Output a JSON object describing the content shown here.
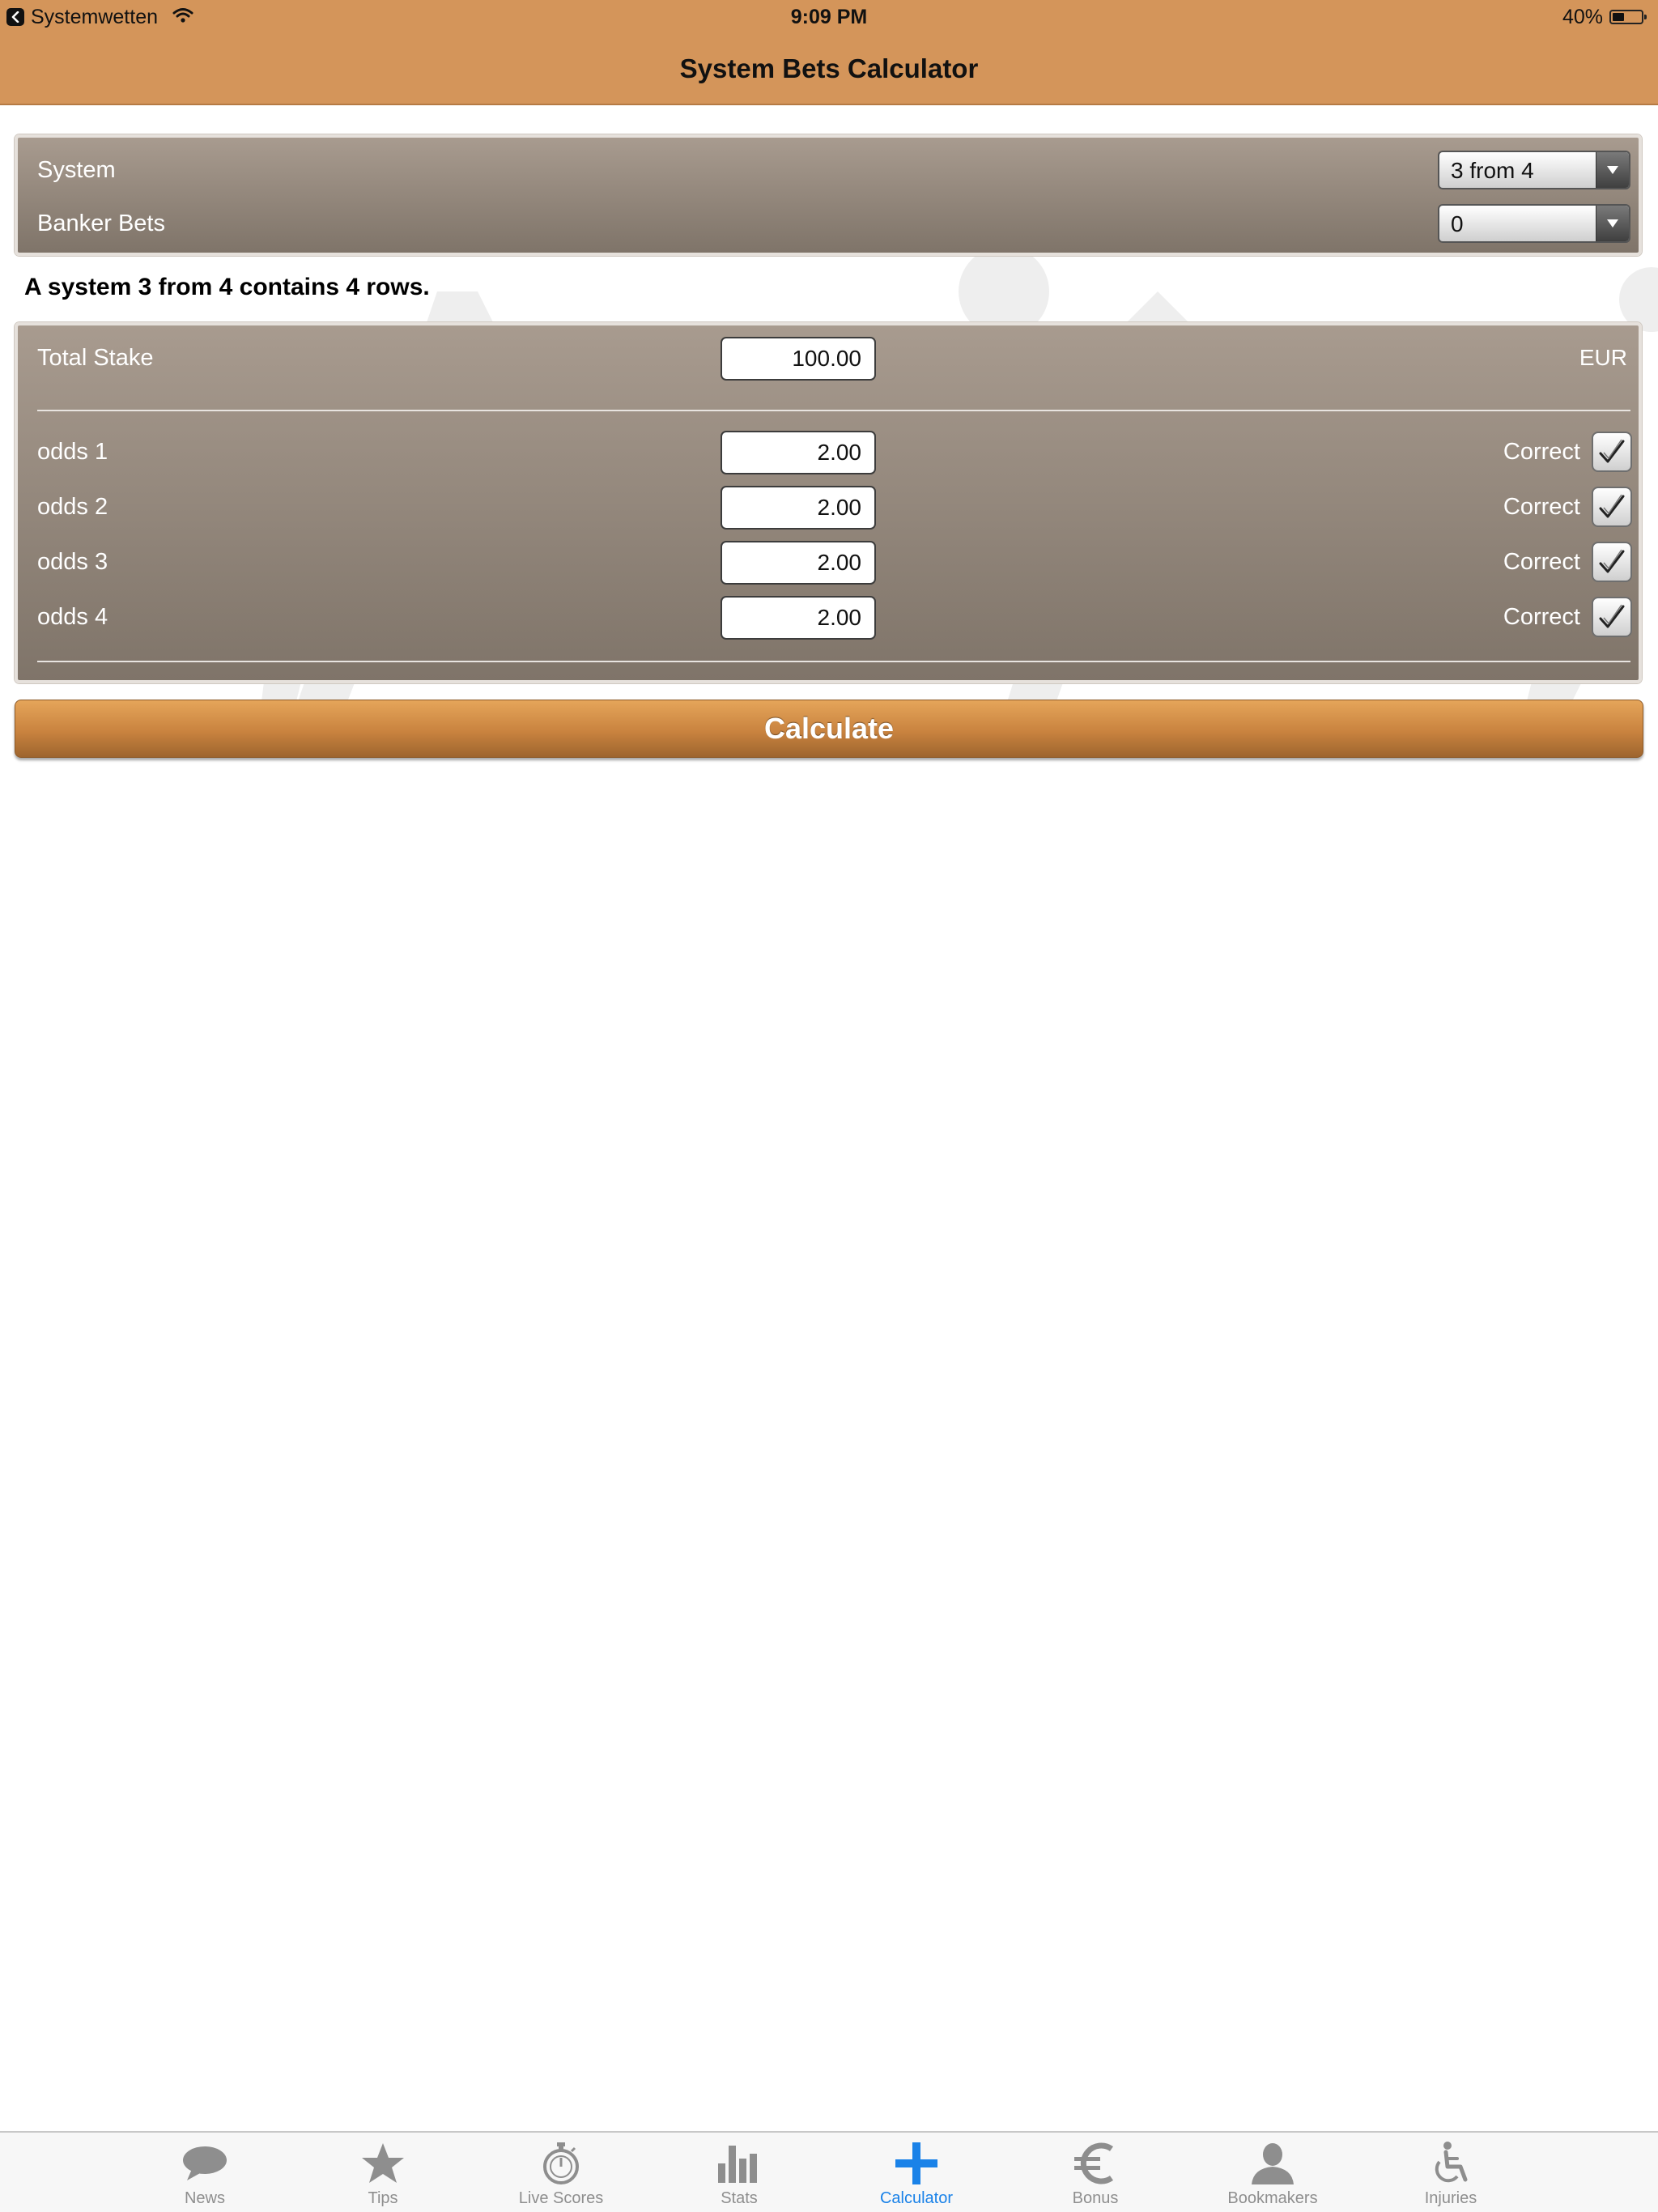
{
  "status_bar": {
    "back_app": "Systemwetten",
    "time": "9:09 PM",
    "battery": "40%",
    "battery_level": 0.4
  },
  "nav": {
    "title": "System Bets Calculator"
  },
  "system_panel": {
    "system_label": "System",
    "system_value": "3 from 4",
    "banker_label": "Banker Bets",
    "banker_value": "0"
  },
  "summary": "A system 3 from 4 contains 4 rows.",
  "stake": {
    "label": "Total Stake",
    "value": "100.00",
    "currency": "EUR"
  },
  "odds": [
    {
      "label": "odds 1",
      "value": "2.00",
      "status": "Correct",
      "checked": true
    },
    {
      "label": "odds 2",
      "value": "2.00",
      "status": "Correct",
      "checked": true
    },
    {
      "label": "odds 3",
      "value": "2.00",
      "status": "Correct",
      "checked": true
    },
    {
      "label": "odds 4",
      "value": "2.00",
      "status": "Correct",
      "checked": true
    }
  ],
  "calculate_label": "Calculate",
  "tabs": [
    {
      "label": "News",
      "icon": "speech-bubble-icon"
    },
    {
      "label": "Tips",
      "icon": "star-icon"
    },
    {
      "label": "Live Scores",
      "icon": "stopwatch-icon"
    },
    {
      "label": "Stats",
      "icon": "bar-chart-icon"
    },
    {
      "label": "Calculator",
      "icon": "plus-icon",
      "active": true
    },
    {
      "label": "Bonus",
      "icon": "euro-icon"
    },
    {
      "label": "Bookmakers",
      "icon": "person-icon"
    },
    {
      "label": "Injuries",
      "icon": "wheelchair-icon"
    }
  ],
  "colors": {
    "header": "#d4955a",
    "panel_top": "#a89b8f",
    "panel_bottom": "#7f7469",
    "button": "#c9833f",
    "tab_active": "#1a82e8",
    "tab_inactive": "#8e8e8e"
  }
}
